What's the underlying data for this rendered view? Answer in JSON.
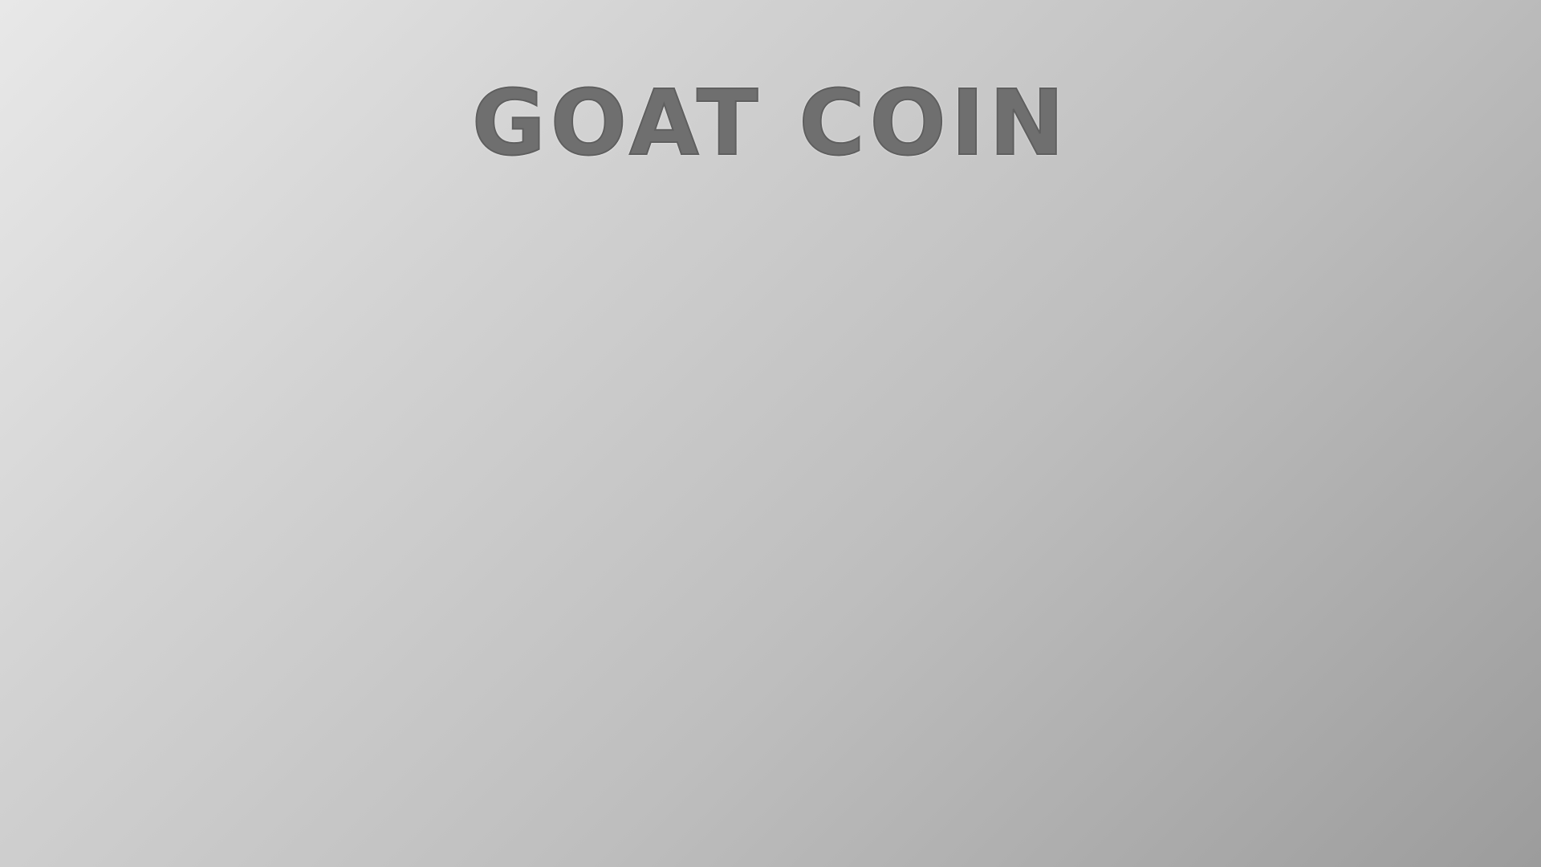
{
  "page": {
    "title": "GOAT COIN"
  },
  "colors": {
    "background_start": "#e8e8e8",
    "background_end": "#9c9c9c",
    "title_fill": "#6f6f6f",
    "title_outline": "#ffffff"
  }
}
